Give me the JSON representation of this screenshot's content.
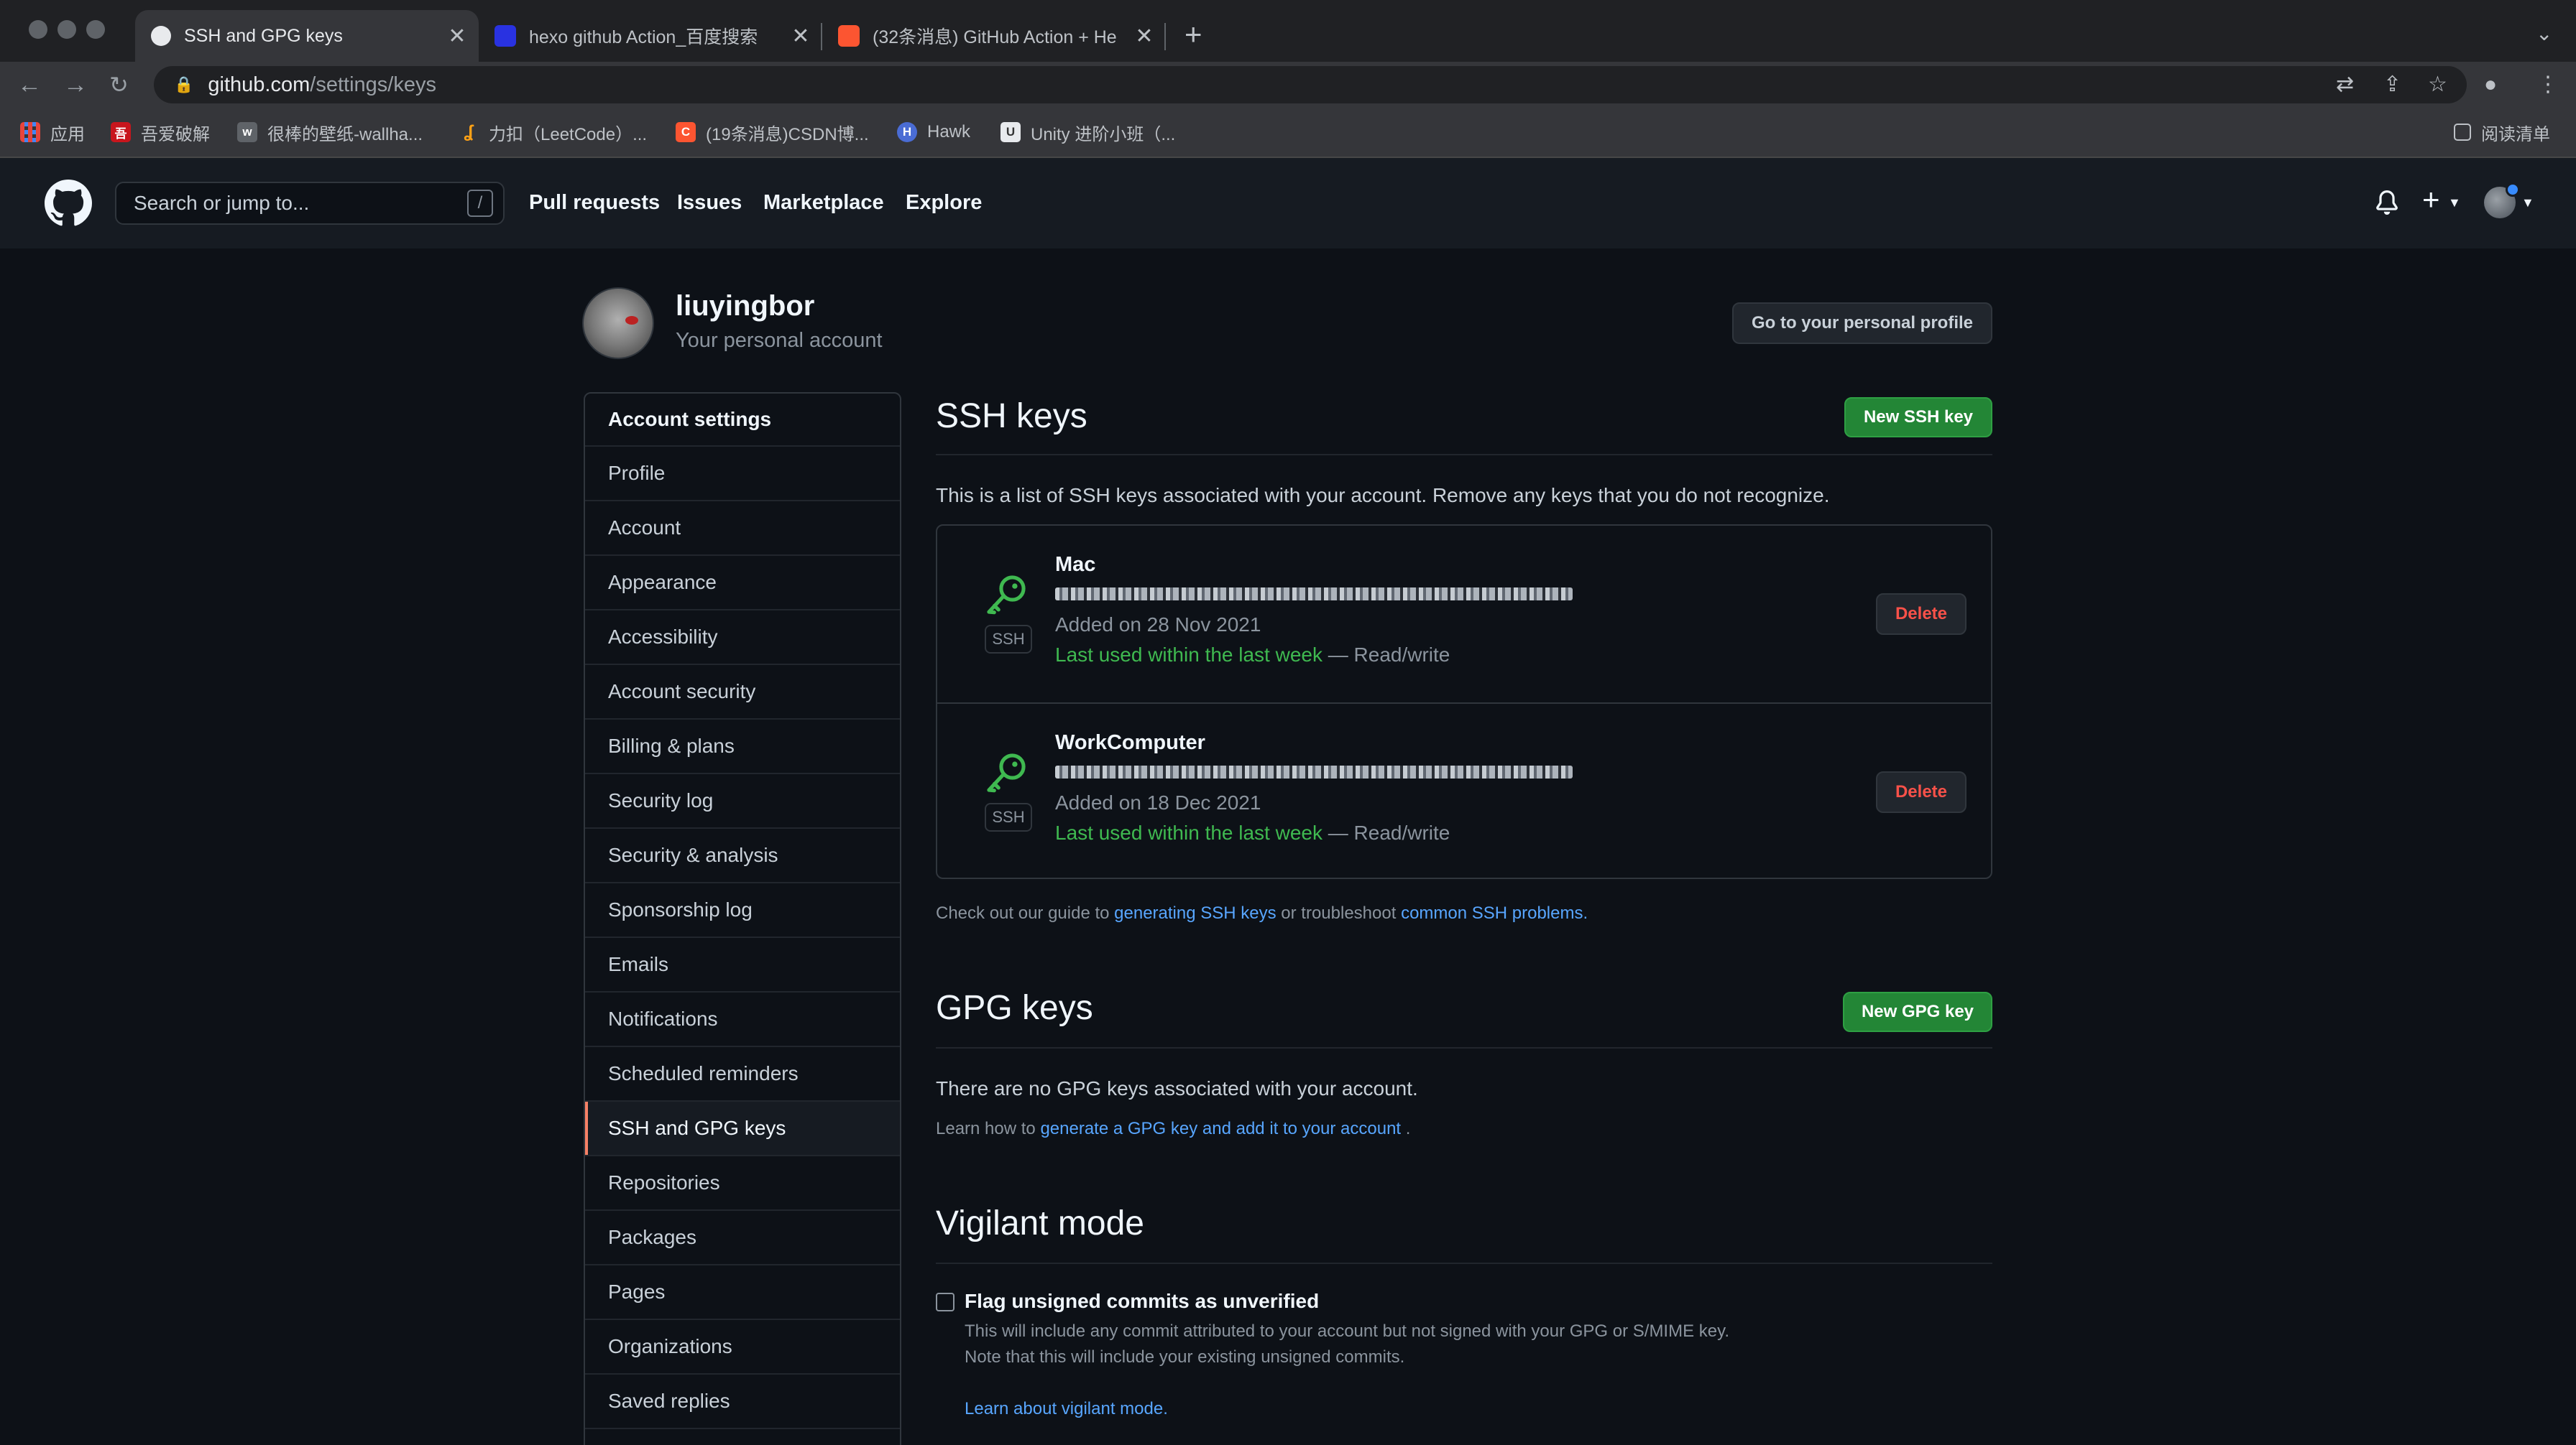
{
  "browser": {
    "tabs": [
      {
        "title": "SSH and GPG keys",
        "active": true,
        "favicon_color": "#e8eaed"
      },
      {
        "title": "hexo github Action_百度搜索",
        "active": false,
        "favicon_color": "#2932e1"
      },
      {
        "title": "(32条消息) GitHub Action + He",
        "active": false,
        "favicon_color": "#fc5531"
      }
    ],
    "close_glyph": "✕",
    "new_tab_glyph": "+",
    "url_host": "github.com",
    "url_path": "/settings/keys",
    "bookmarks": [
      {
        "label": "应用",
        "icon": "apps-grid-icon",
        "color": "#e8453c"
      },
      {
        "label": "吾爱破解",
        "icon": "52pojie-icon",
        "color": "#c8161d"
      },
      {
        "label": "很棒的壁纸-wallha...",
        "icon": "wallhaven-icon",
        "color": "#5f6368"
      },
      {
        "label": "力扣（LeetCode）...",
        "icon": "leetcode-icon",
        "color": "#ffa116"
      },
      {
        "label": "(19条消息)CSDN博...",
        "icon": "csdn-icon",
        "color": "#fc5531"
      },
      {
        "label": "Hawk",
        "icon": "hawk-icon",
        "color": "#4a6cd4"
      },
      {
        "label": "Unity 进阶小班（...",
        "icon": "unity-icon",
        "color": "#e8eaed"
      }
    ],
    "reading_list": "阅读清单"
  },
  "header": {
    "search_placeholder": "Search or jump to...",
    "search_shortcut": "/",
    "nav": [
      "Pull requests",
      "Issues",
      "Marketplace",
      "Explore"
    ],
    "plus_glyph": "+"
  },
  "profile": {
    "name": "liuyingbor",
    "subtitle": "Your personal account",
    "profile_button": "Go to your personal profile"
  },
  "sidebar": {
    "header": "Account settings",
    "items": [
      "Profile",
      "Account",
      "Appearance",
      "Accessibility",
      "Account security",
      "Billing & plans",
      "Security log",
      "Security & analysis",
      "Sponsorship log",
      "Emails",
      "Notifications",
      "Scheduled reminders",
      "SSH and GPG keys",
      "Repositories",
      "Packages",
      "Pages",
      "Organizations",
      "Saved replies"
    ],
    "selected": "SSH and GPG keys"
  },
  "ssh": {
    "title": "SSH keys",
    "new_button": "New SSH key",
    "description": "This is a list of SSH keys associated with your account. Remove any keys that you do not recognize.",
    "keys": [
      {
        "title": "Mac",
        "badge": "SSH",
        "added": "Added on 28 Nov 2021",
        "last_used": "Last used within the last week",
        "access": " — Read/write",
        "delete_label": "Delete"
      },
      {
        "title": "WorkComputer",
        "badge": "SSH",
        "added": "Added on 18 Dec 2021",
        "last_used": "Last used within the last week",
        "access": " — Read/write",
        "delete_label": "Delete"
      }
    ],
    "guide_prefix": "Check out our guide to ",
    "guide_link1": "generating SSH keys",
    "guide_mid": " or troubleshoot ",
    "guide_link2": "common SSH problems."
  },
  "gpg": {
    "title": "GPG keys",
    "new_button": "New GPG key",
    "empty": "There are no GPG keys associated with your account.",
    "learn_prefix": "Learn how to ",
    "learn_link": "generate a GPG key and add it to your account",
    "learn_suffix": " ."
  },
  "vigilant": {
    "title": "Vigilant mode",
    "checkbox_label": "Flag unsigned commits as unverified",
    "checked": false,
    "desc1": "This will include any commit attributed to your account but not signed with your GPG or S/MIME key.",
    "desc2": "Note that this will include your existing unsigned commits.",
    "learn_link": "Learn about vigilant mode."
  }
}
